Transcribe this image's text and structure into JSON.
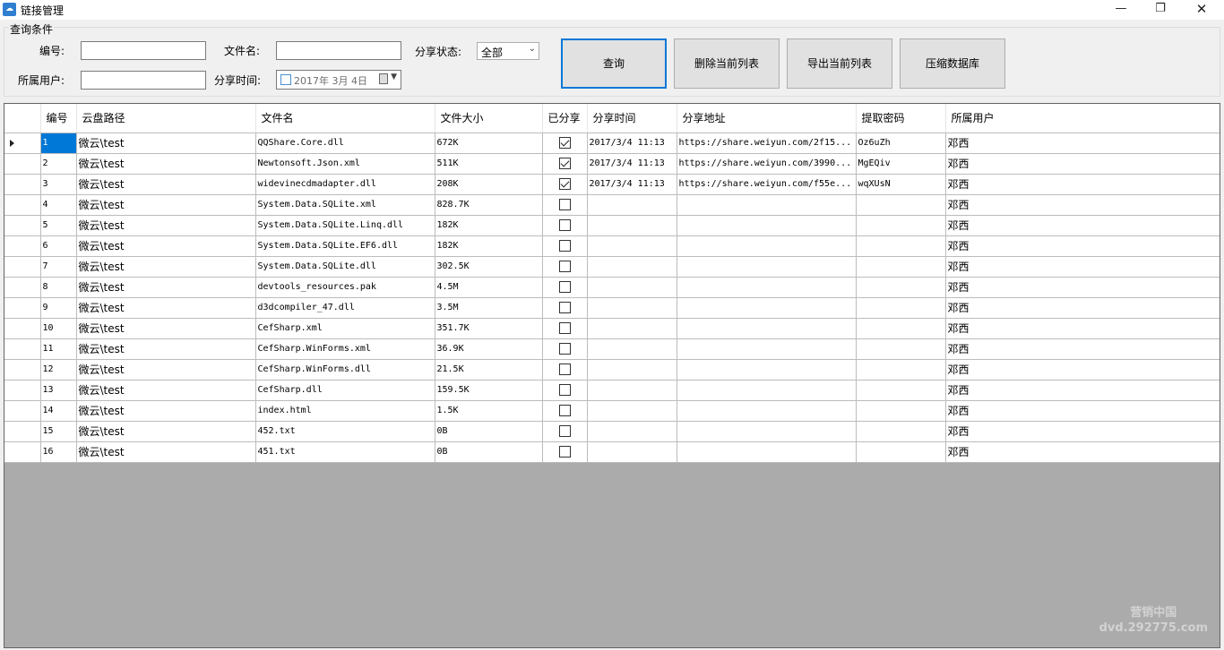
{
  "window": {
    "title": "链接管理",
    "icon_glyph": "☁",
    "min_glyph": "—",
    "max_glyph": "❐",
    "close_glyph": "✕"
  },
  "query": {
    "legend": "查询条件",
    "id_label": "编号:",
    "filename_label": "文件名:",
    "share_status_label": "分享状态:",
    "share_status_value": "全部",
    "user_label": "所属用户:",
    "share_time_label": "分享时间:",
    "share_time_value": "2017年  3月  4日",
    "id_value": "",
    "filename_value": "",
    "user_value": ""
  },
  "buttons": {
    "query": "查询",
    "delete_list": "删除当前列表",
    "export_list": "导出当前列表",
    "compress_db": "压缩数据库"
  },
  "grid": {
    "columns": [
      "编号",
      "云盘路径",
      "文件名",
      "文件大小",
      "已分享",
      "分享时间",
      "分享地址",
      "提取密码",
      "所属用户"
    ],
    "rows": [
      {
        "id": "1",
        "path": "微云\\test",
        "name": "QQShare.Core.dll",
        "size": "672K",
        "shared": true,
        "time": "2017/3/4 11:13",
        "url": "https://share.weiyun.com/2f15...",
        "pwd": "Oz6uZh",
        "user": "邓西"
      },
      {
        "id": "2",
        "path": "微云\\test",
        "name": "Newtonsoft.Json.xml",
        "size": "511K",
        "shared": true,
        "time": "2017/3/4 11:13",
        "url": "https://share.weiyun.com/3990...",
        "pwd": "MgEQiv",
        "user": "邓西"
      },
      {
        "id": "3",
        "path": "微云\\test",
        "name": "widevinecdmadapter.dll",
        "size": "208K",
        "shared": true,
        "time": "2017/3/4 11:13",
        "url": "https://share.weiyun.com/f55e...",
        "pwd": "wqXUsN",
        "user": "邓西"
      },
      {
        "id": "4",
        "path": "微云\\test",
        "name": "System.Data.SQLite.xml",
        "size": "828.7K",
        "shared": false,
        "time": "",
        "url": "",
        "pwd": "",
        "user": "邓西"
      },
      {
        "id": "5",
        "path": "微云\\test",
        "name": "System.Data.SQLite.Linq.dll",
        "size": "182K",
        "shared": false,
        "time": "",
        "url": "",
        "pwd": "",
        "user": "邓西"
      },
      {
        "id": "6",
        "path": "微云\\test",
        "name": "System.Data.SQLite.EF6.dll",
        "size": "182K",
        "shared": false,
        "time": "",
        "url": "",
        "pwd": "",
        "user": "邓西"
      },
      {
        "id": "7",
        "path": "微云\\test",
        "name": "System.Data.SQLite.dll",
        "size": "302.5K",
        "shared": false,
        "time": "",
        "url": "",
        "pwd": "",
        "user": "邓西"
      },
      {
        "id": "8",
        "path": "微云\\test",
        "name": "devtools_resources.pak",
        "size": "4.5M",
        "shared": false,
        "time": "",
        "url": "",
        "pwd": "",
        "user": "邓西"
      },
      {
        "id": "9",
        "path": "微云\\test",
        "name": "d3dcompiler_47.dll",
        "size": "3.5M",
        "shared": false,
        "time": "",
        "url": "",
        "pwd": "",
        "user": "邓西"
      },
      {
        "id": "10",
        "path": "微云\\test",
        "name": "CefSharp.xml",
        "size": "351.7K",
        "shared": false,
        "time": "",
        "url": "",
        "pwd": "",
        "user": "邓西"
      },
      {
        "id": "11",
        "path": "微云\\test",
        "name": "CefSharp.WinForms.xml",
        "size": "36.9K",
        "shared": false,
        "time": "",
        "url": "",
        "pwd": "",
        "user": "邓西"
      },
      {
        "id": "12",
        "path": "微云\\test",
        "name": "CefSharp.WinForms.dll",
        "size": "21.5K",
        "shared": false,
        "time": "",
        "url": "",
        "pwd": "",
        "user": "邓西"
      },
      {
        "id": "13",
        "path": "微云\\test",
        "name": "CefSharp.dll",
        "size": "159.5K",
        "shared": false,
        "time": "",
        "url": "",
        "pwd": "",
        "user": "邓西"
      },
      {
        "id": "14",
        "path": "微云\\test",
        "name": "index.html",
        "size": "1.5K",
        "shared": false,
        "time": "",
        "url": "",
        "pwd": "",
        "user": "邓西"
      },
      {
        "id": "15",
        "path": "微云\\test",
        "name": "452.txt",
        "size": "0B",
        "shared": false,
        "time": "",
        "url": "",
        "pwd": "",
        "user": "邓西"
      },
      {
        "id": "16",
        "path": "微云\\test",
        "name": "451.txt",
        "size": "0B",
        "shared": false,
        "time": "",
        "url": "",
        "pwd": "",
        "user": "邓西"
      }
    ]
  },
  "watermark": {
    "line1": "营销中国",
    "line2": "dvd.292775.com"
  },
  "colors": {
    "selection": "#0078d7",
    "grid_empty": "#ababab",
    "default_button_border": "#0078d7"
  }
}
